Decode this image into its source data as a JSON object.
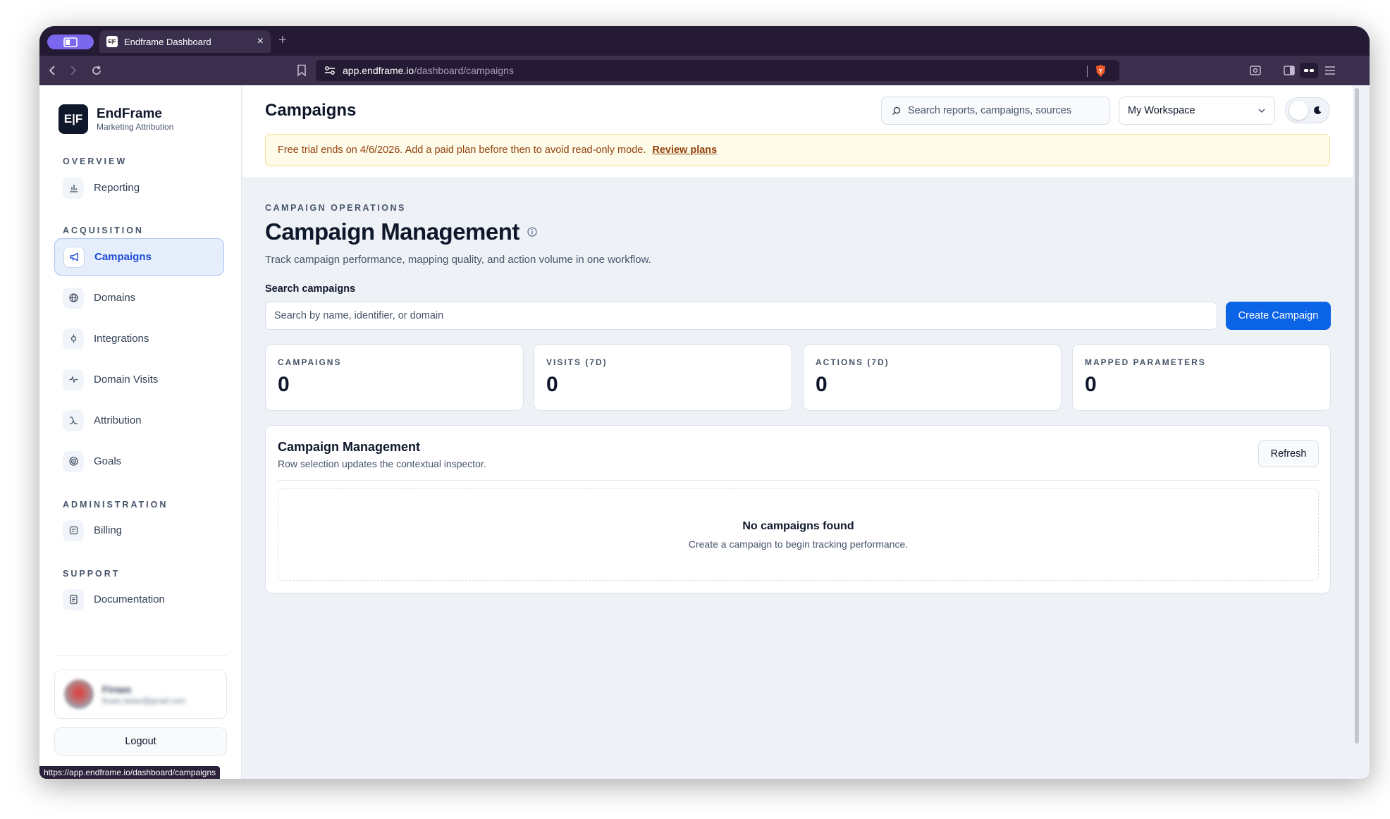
{
  "browser": {
    "tab_title": "Endframe Dashboard",
    "tab_favicon_text": "E|F",
    "new_tab_label": "+",
    "close_tab_label": "×",
    "url_host": "app.endframe.io",
    "url_path": "/dashboard/campaigns",
    "status_url": "https://app.endframe.io/dashboard/campaigns",
    "accent_color": "#7c68ee"
  },
  "sidebar": {
    "logo_text": "E|F",
    "brand_name": "EndFrame",
    "brand_tagline": "Marketing Attribution",
    "sections": {
      "overview": "OVERVIEW",
      "acquisition": "ACQUISITION",
      "administration": "ADMINISTRATION",
      "support": "SUPPORT"
    },
    "items": {
      "reporting": "Reporting",
      "campaigns": "Campaigns",
      "domains": "Domains",
      "integrations": "Integrations",
      "domain_visits": "Domain Visits",
      "attribution": "Attribution",
      "goals": "Goals",
      "billing": "Billing",
      "documentation": "Documentation"
    },
    "active_item": "campaigns",
    "user_name": "Firaas",
    "user_email": "firaas.lastar@gmail.com",
    "logout_label": "Logout"
  },
  "header": {
    "title": "Campaigns",
    "search_placeholder": "Search reports, campaigns, sources",
    "workspace": "My Workspace"
  },
  "banner": {
    "text": "Free trial ends on 4/6/2026. Add a paid plan before then to avoid read-only mode.",
    "link": "Review plans"
  },
  "page": {
    "eyebrow": "CAMPAIGN OPERATIONS",
    "heading": "Campaign Management",
    "lead": "Track campaign performance, mapping quality, and action volume in one workflow.",
    "search_label": "Search campaigns",
    "search_placeholder": "Search by name, identifier, or domain",
    "create_button": "Create Campaign",
    "primary_color": "#0b63e5"
  },
  "stats": [
    {
      "label": "CAMPAIGNS",
      "value": "0"
    },
    {
      "label": "VISITS (7D)",
      "value": "0"
    },
    {
      "label": "ACTIONS (7D)",
      "value": "0"
    },
    {
      "label": "MAPPED PARAMETERS",
      "value": "0"
    }
  ],
  "panel": {
    "title": "Campaign Management",
    "subtitle": "Row selection updates the contextual inspector.",
    "refresh_label": "Refresh",
    "empty_title": "No campaigns found",
    "empty_subtitle": "Create a campaign to begin tracking performance."
  }
}
